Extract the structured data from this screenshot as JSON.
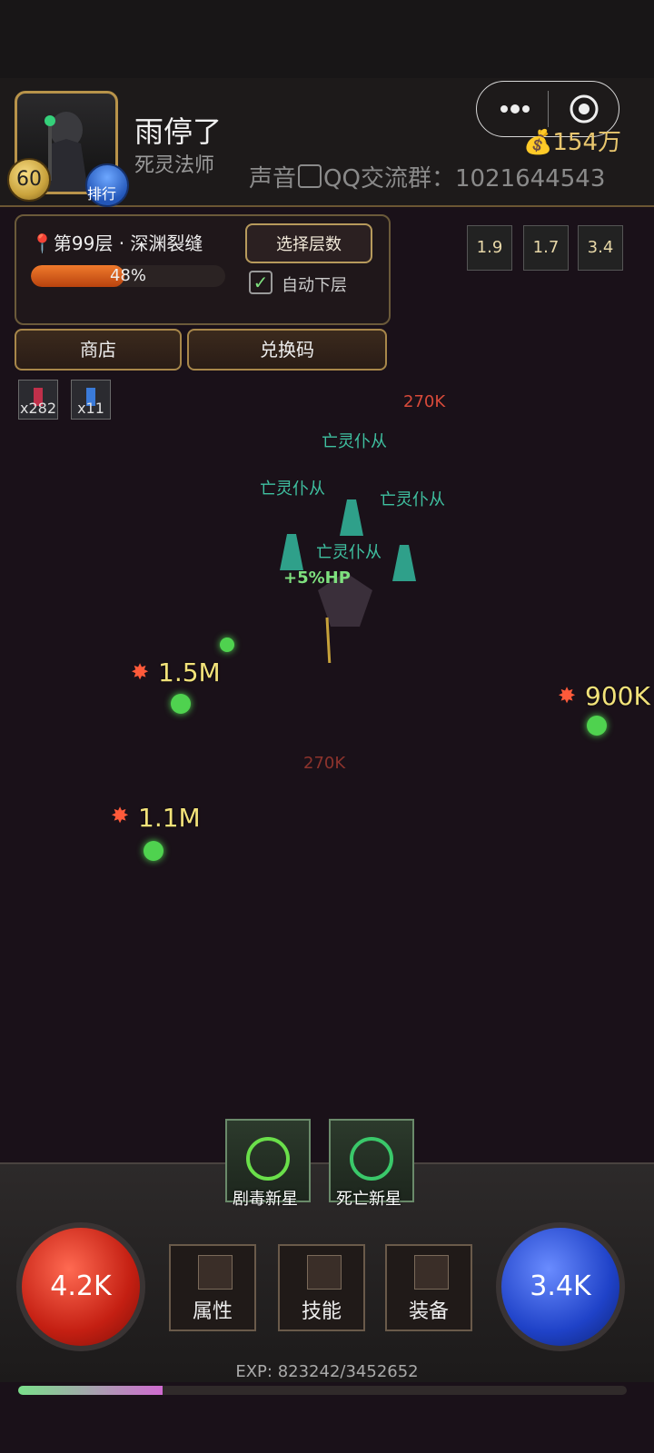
{
  "player": {
    "level": "60",
    "name": "雨停了",
    "class": "死灵法师",
    "rank_label": "排行"
  },
  "header": {
    "gold": "154万",
    "sound_label": "声音",
    "qq_group": "QQ交流群：1021644543"
  },
  "floor": {
    "name": "第99层 · 深渊裂缝",
    "progress_text": "48%",
    "progress_value": 0.48,
    "select_label": "选择层数",
    "auto_label": "自动下层",
    "auto_checked": true
  },
  "buttons": {
    "shop": "商店",
    "redeem": "兑换码"
  },
  "potions": [
    {
      "count": "x282"
    },
    {
      "count": "x11"
    }
  ],
  "buffs": [
    "1.9",
    "1.7",
    "3.4"
  ],
  "battle": {
    "damage_top": "270K",
    "damage_mid": "270K",
    "minion_label": "亡灵仆从",
    "hp_bonus": "+5%HP",
    "big_hits": [
      "1.5M",
      "900K",
      "1.1M"
    ]
  },
  "skills": [
    "剧毒新星",
    "死亡新星"
  ],
  "orbs": {
    "hp": "4.2K",
    "mp": "3.4K"
  },
  "menu": [
    "属性",
    "技能",
    "装备"
  ],
  "exp": {
    "text": "EXP: 823242/3452652",
    "progress_value": 0.238
  }
}
